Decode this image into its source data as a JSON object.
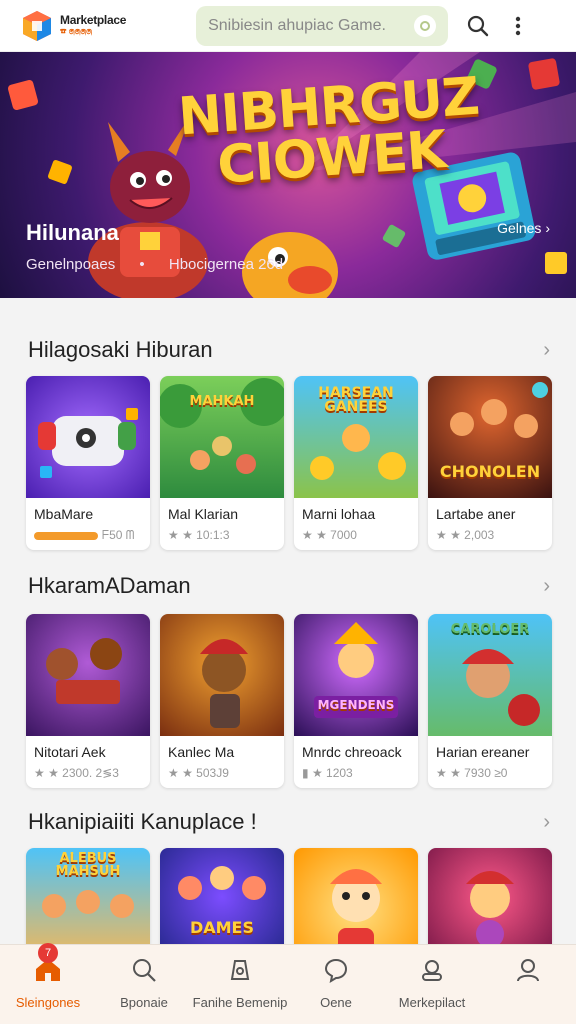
{
  "header": {
    "logo_title": "Marketplace",
    "logo_sub": "☎ ෧෧෧෧",
    "search_placeholder": "Snibiesin ahupiac Game.",
    "colors": {
      "accent": "#e65c00",
      "search_bg": "#e7f0d9"
    }
  },
  "hero": {
    "title_line1": "NIBHRGUZ",
    "title_line2": "CIOWEK",
    "name": "Hilunana",
    "meta": [
      "Genelnpoaes",
      "•",
      "Hbocigernea 26d"
    ],
    "link": "Gelnes ›"
  },
  "sections": [
    {
      "title": "Hilagosaki Hiburan",
      "cards": [
        {
          "name": "MbaMare",
          "meta": "ᖴ50   ᗰ",
          "badge": true,
          "art": "console"
        },
        {
          "name": "Mal Klarian",
          "meta": "★ ★ 10:1:3",
          "art": "jungle"
        },
        {
          "name": "Marni lohaa",
          "meta": "★ ★ 7000",
          "art": "hansean"
        },
        {
          "name": "Lartabe aner",
          "meta": "★ ★ 2,003",
          "art": "chonolen"
        }
      ]
    },
    {
      "title": "HkaramADaman",
      "cards": [
        {
          "name": "Nitotari Aek",
          "meta": "★ ★ 2300. 2≶3",
          "art": "monkeys"
        },
        {
          "name": "Kanlec Ma",
          "meta": "★ ★ 503J9",
          "art": "runner"
        },
        {
          "name": "Mnrdc chreoack",
          "meta": "▮ ★ 1203",
          "art": "neon"
        },
        {
          "name": "Harian ereaner",
          "meta": "★ ★ 7930 ≥0",
          "art": "boxer"
        }
      ]
    },
    {
      "title": "Hkanipiaiiti Kanuplace !",
      "cards": [
        {
          "art": "crowd"
        },
        {
          "art": "dames"
        },
        {
          "art": "girl"
        },
        {
          "art": "portrait"
        }
      ]
    }
  ],
  "nav": {
    "items": [
      {
        "label": "Sleingones",
        "icon": "home-icon",
        "active": true,
        "badge": "7"
      },
      {
        "label": "Bponaie",
        "icon": "search-icon"
      },
      {
        "label": "Fanihe Bemenip",
        "icon": "game-icon"
      },
      {
        "label": "Oene",
        "icon": "chat-icon"
      },
      {
        "label": "Merkepilact",
        "icon": "store-icon"
      },
      {
        "label": "",
        "icon": "profile-icon"
      }
    ]
  }
}
